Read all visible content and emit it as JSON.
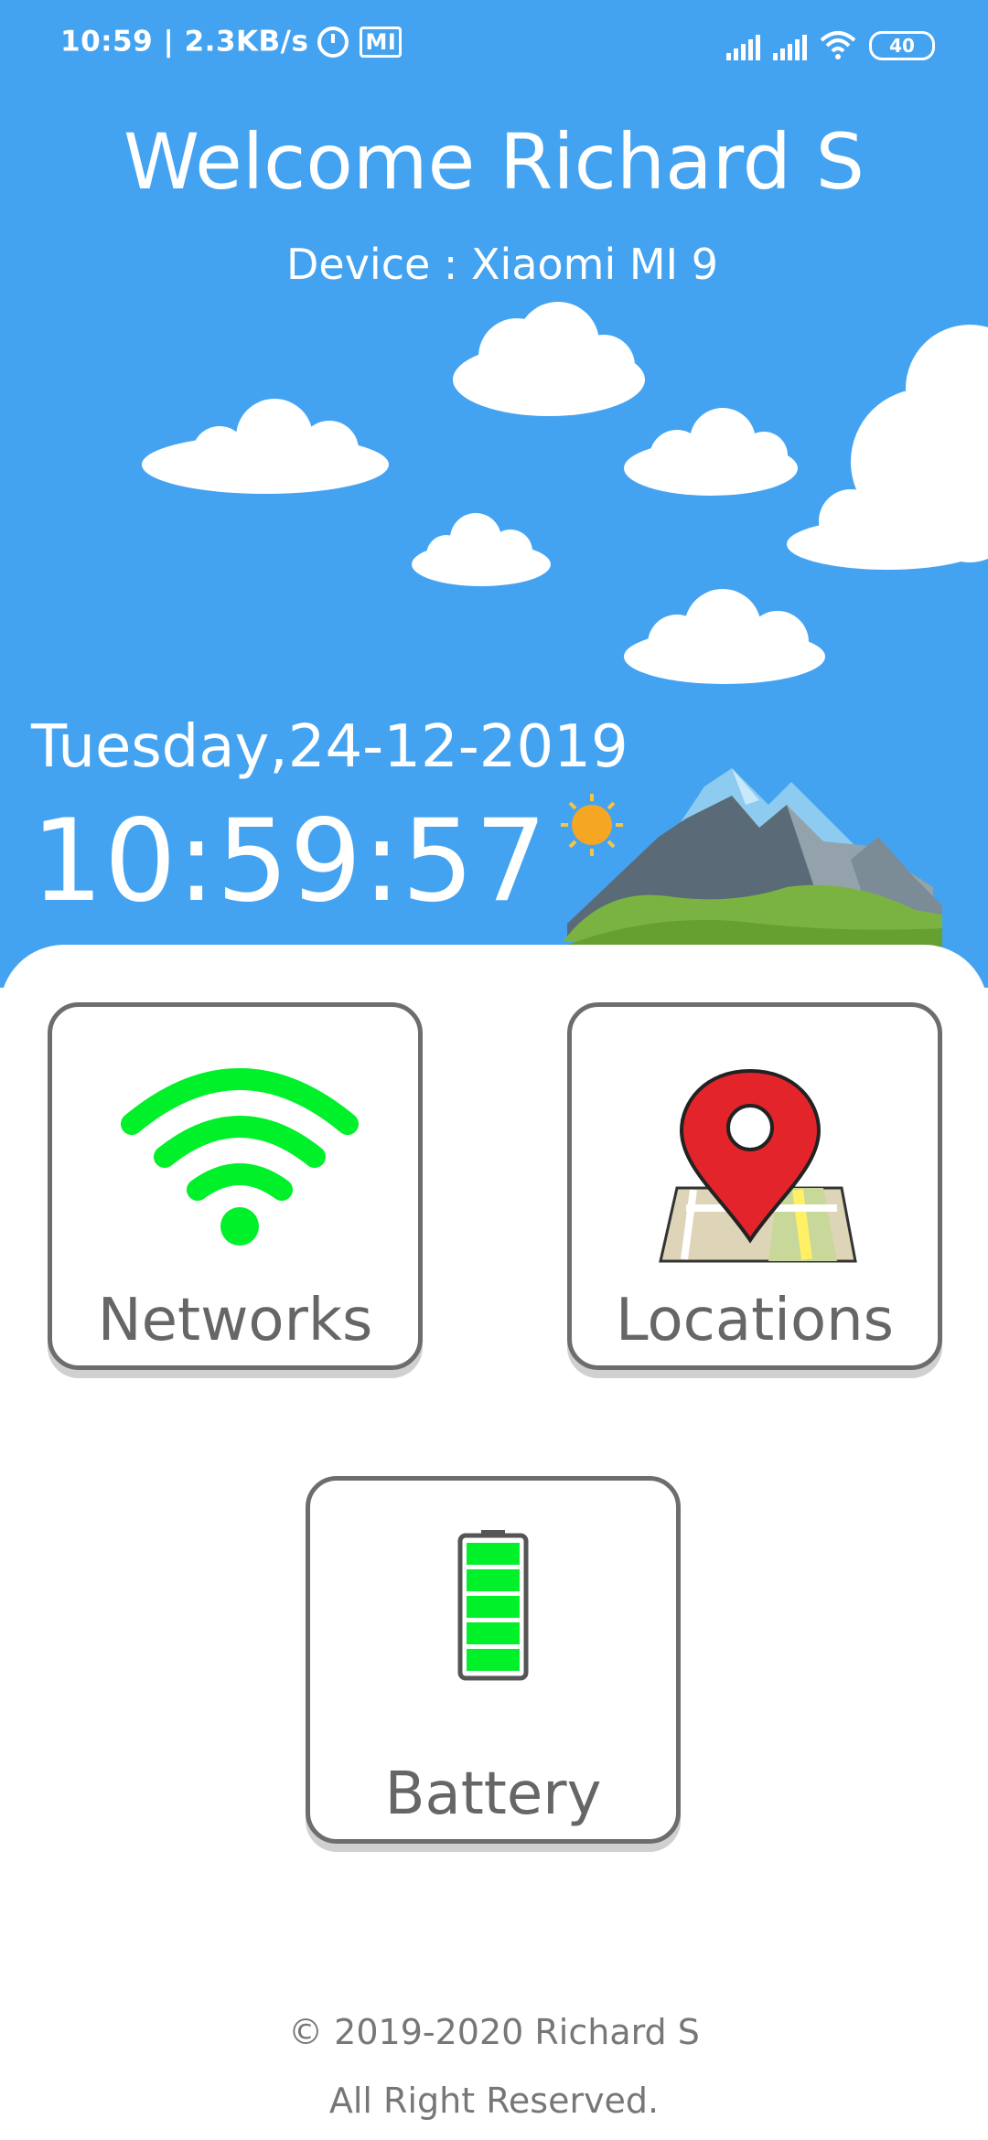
{
  "status_bar": {
    "time": "10:59",
    "speed": "2.3KB/s",
    "mi_badge": "MI",
    "battery_level": "40"
  },
  "header": {
    "welcome": "Welcome Richard S",
    "device": "Device : Xiaomi MI 9"
  },
  "clock": {
    "date": "Tuesday,24-12-2019",
    "time": "10:59:57"
  },
  "tiles": [
    {
      "label": "Networks",
      "icon": "wifi-icon"
    },
    {
      "label": "Locations",
      "icon": "map-pin-icon"
    },
    {
      "label": "Battery",
      "icon": "battery-icon"
    }
  ],
  "footer": {
    "copyright": "© 2019-2020 Richard S",
    "rights": "All Right Reserved."
  },
  "colors": {
    "sky": "#44a3f1",
    "accent_green": "#00f02a",
    "pin_red": "#e3242b",
    "tile_border": "#6d6d6d"
  }
}
